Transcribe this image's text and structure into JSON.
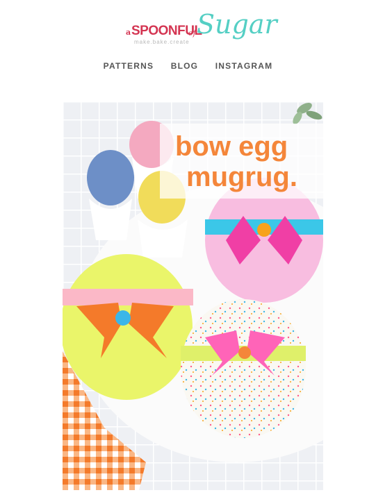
{
  "logo": {
    "a": "a",
    "spoonful": "SPOONFUL",
    "of": "of",
    "sugar": "Sugar",
    "tagline": "make.bake.create"
  },
  "nav": {
    "items": [
      "PATTERNS",
      "BLOG",
      "INSTAGRAM"
    ]
  },
  "hero": {
    "title_line1": "bow egg",
    "title_line2": "mugrug.",
    "title_color": "#f4863a"
  },
  "colors": {
    "accent_pink": "#d43552",
    "accent_teal": "#55cfc4",
    "nav_text": "#555555"
  }
}
